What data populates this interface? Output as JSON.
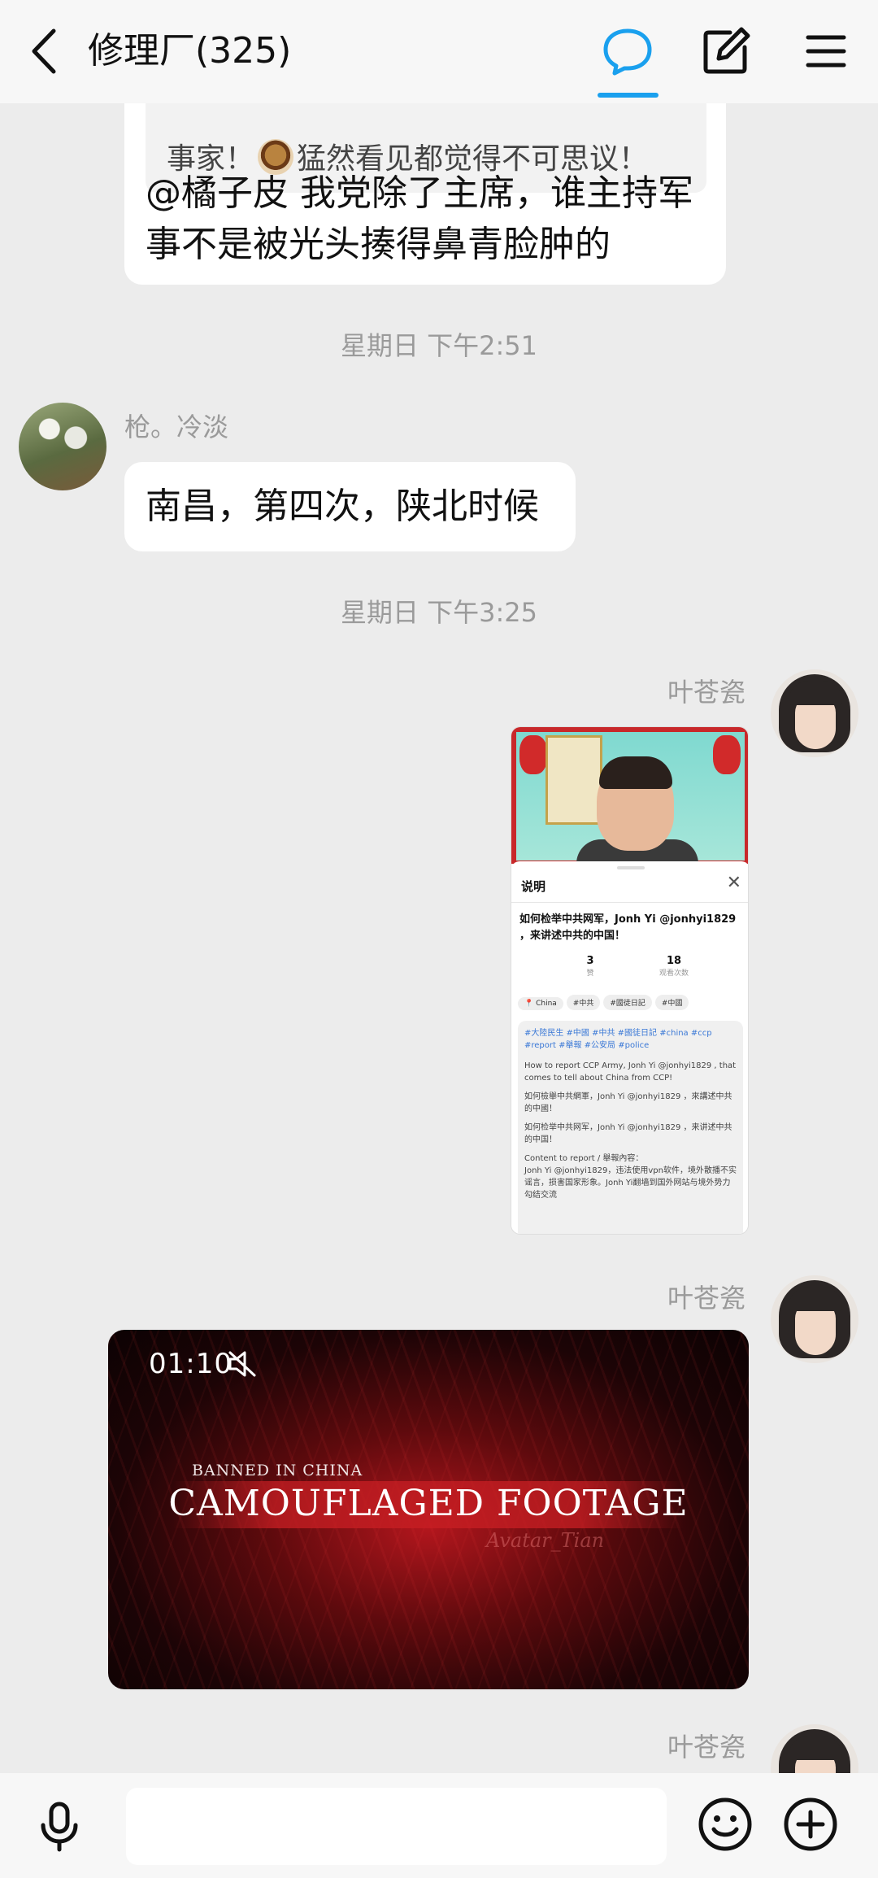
{
  "header": {
    "title": "修理厂(325)",
    "active_color": "#1aa0ee"
  },
  "messages": {
    "quoted": {
      "text_before": "事家！",
      "text_after": "猛然看见都觉得不可思议！"
    },
    "msg1": {
      "text": "@橘子皮 我党除了主席，谁主持军事不是被光头揍得鼻青脸肿的"
    },
    "ts1": "星期日 下午2:51",
    "msg2": {
      "sender": "枪。冷淡",
      "text": "南昌，第四次，陕北时候"
    },
    "ts2": "星期日 下午3:25",
    "msg3": {
      "sender": "叶苍瓷",
      "screenshot": {
        "panel_title": "说明",
        "video_title": "如何检举中共网军，Jonh Yi @jonhyi1829 ，来讲述中共的中国！",
        "stats": [
          {
            "value": "3",
            "label": "赞"
          },
          {
            "value": "18",
            "label": "观看次数"
          }
        ],
        "tags": [
          "China",
          "#中共",
          "#國徒日記",
          "#中國"
        ],
        "hashtags": "#大陸民生 #中國 #中共 #國徒日記 #china #ccp #report #舉報 #公安局 #police",
        "paragraphs": [
          "How to report CCP Army, Jonh Yi @jonhyi1829 , that comes to tell about China from CCP!",
          "如何檢舉中共網軍，Jonh Yi @jonhyi1829 ，來講述中共的中國！",
          "如何检举中共网军，Jonh Yi @jonhyi1829 ，来讲述中共的中国！",
          "Content to report / 舉報內容：",
          "Jonh Yi @jonhyi1829，违法使用vpn软件，境外散播不实谣言，损害国家形象。Jonh Yi翻墙到国外网站与境外势力勾结交流"
        ]
      }
    },
    "msg4": {
      "sender": "叶苍瓷",
      "video": {
        "duration": "01:10",
        "subtitle": "BANNED IN CHINA",
        "title": "CAMOUFLAGED FOOTAGE",
        "watermark": "Avatar_Tian"
      }
    },
    "msg5": {
      "sender": "叶苍瓷"
    }
  },
  "icons": {
    "back": "back-arrow-icon",
    "chat": "chat-bubble-icon",
    "edit": "edit-icon",
    "menu": "menu-icon",
    "mic": "microphone-icon",
    "emoji": "emoji-icon",
    "plus": "plus-icon",
    "mute": "mute-icon"
  }
}
